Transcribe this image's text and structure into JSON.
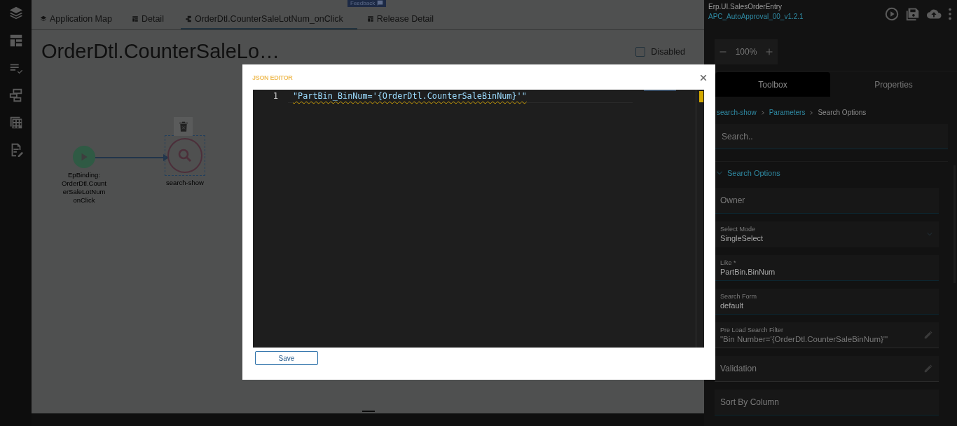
{
  "tabs": [
    {
      "label": "Application Map",
      "selected": false,
      "kind": "layers"
    },
    {
      "label": "Detail",
      "selected": false,
      "kind": "table"
    },
    {
      "label": "OrderDtl.CounterSaleLotNum_onClick",
      "selected": true,
      "kind": "flow"
    },
    {
      "label": "Release Detail",
      "selected": false,
      "kind": "table"
    }
  ],
  "feedback_badge": "Feedback",
  "page_title": "OrderDtl.CounterSaleLo…",
  "disabled_checkbox": {
    "label": "Disabled",
    "checked": false
  },
  "diagram": {
    "nodes": [
      {
        "kind": "start",
        "label": "EpBinding: OrderDtl.CounterSaleLotNum onClick",
        "selected": false
      },
      {
        "kind": "search",
        "label": "search-show",
        "selected": true
      }
    ]
  },
  "right_panel": {
    "app_name": "Erp.UI.SalesOrderEntry",
    "layer_name": "APC_AutoApproval_00_v1.2.1",
    "zoom": "100%",
    "tabs": [
      {
        "label": "Toolbox",
        "selected": true
      },
      {
        "label": "Properties",
        "selected": false
      }
    ],
    "breadcrumb": [
      {
        "label": "search-show",
        "kind": "link"
      },
      {
        "label": "Parameters",
        "kind": "link"
      },
      {
        "label": "Search Options",
        "kind": "current"
      }
    ],
    "search": {
      "placeholder": "Search.."
    },
    "section": {
      "title": "Search Options",
      "expanded": true
    },
    "fields": [
      {
        "kind": "empty",
        "label": "Owner"
      },
      {
        "kind": "dropdown",
        "label": "Select Mode",
        "value": "SingleSelect"
      },
      {
        "kind": "text",
        "label": "Like *",
        "value": "PartBin.BinNum"
      },
      {
        "kind": "text",
        "label": "Search Form",
        "value": "default"
      },
      {
        "kind": "editable",
        "label": "Pre Load Search Filter",
        "value": "\"Bin Number='{OrderDtl.CounterSaleBinNum}'\""
      },
      {
        "kind": "editable-empty",
        "label": "Validation"
      },
      {
        "kind": "empty",
        "label": "Sort By Column"
      }
    ]
  },
  "modal": {
    "title": "JSON EDITOR",
    "lines": [
      {
        "number": "1",
        "text": "\"PartBin_BinNum='{OrderDtl.CounterSaleBinNum}'\""
      }
    ],
    "save_button": "Save"
  }
}
